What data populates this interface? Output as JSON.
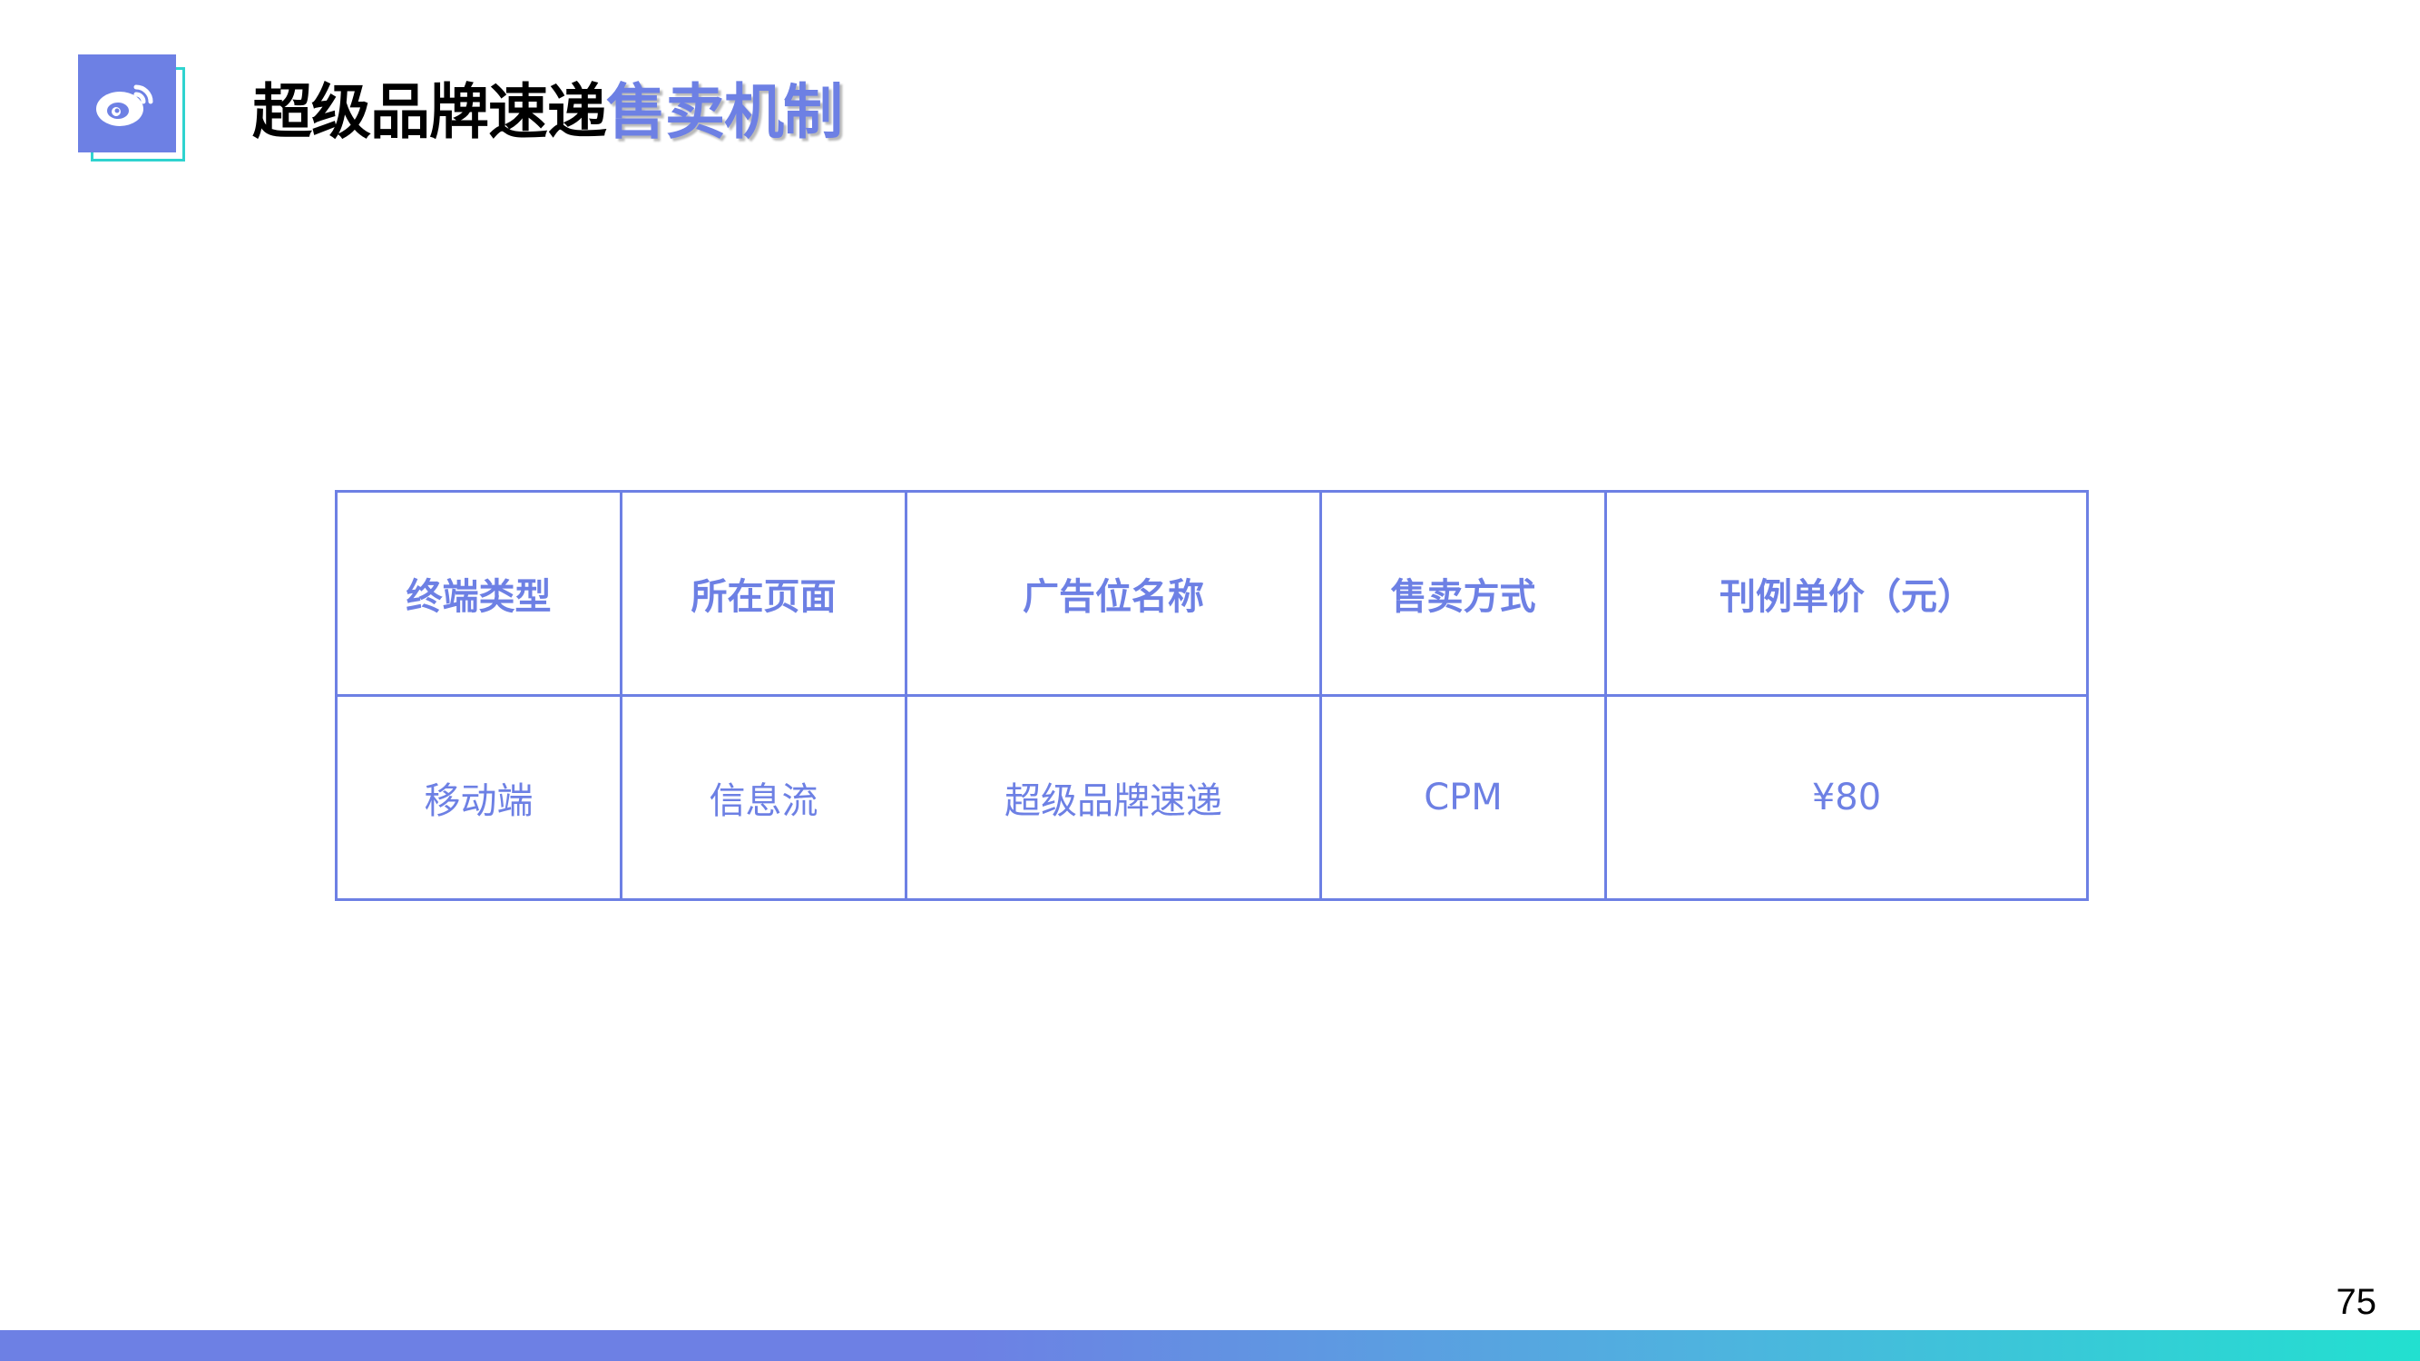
{
  "header": {
    "title_part1": "超级品牌速递",
    "title_part2": "售卖机制",
    "logo_icon": "weibo-logo-icon"
  },
  "colors": {
    "accent": "#6d80e4",
    "teal": "#22e0d0",
    "text": "#000000"
  },
  "table": {
    "headers": [
      "终端类型",
      "所在页面",
      "广告位名称",
      "售卖方式",
      "刊例单价（元）"
    ],
    "rows": [
      [
        "移动端",
        "信息流",
        "超级品牌速递",
        "CPM",
        "¥80"
      ]
    ]
  },
  "footer": {
    "page_number": "75"
  }
}
